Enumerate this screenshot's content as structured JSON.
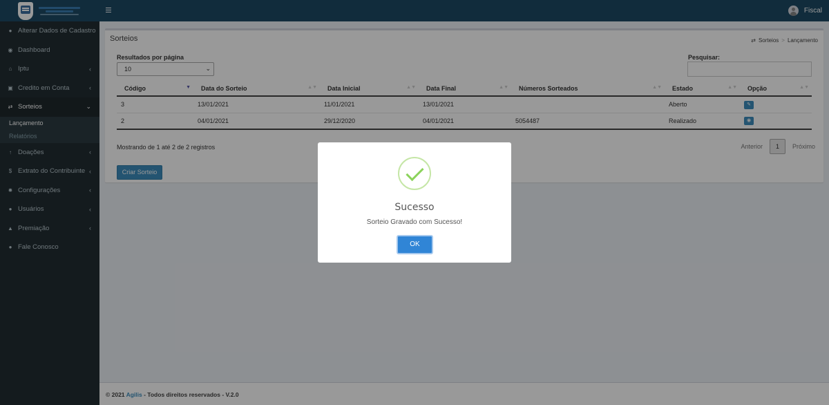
{
  "header": {
    "user_name": "Fiscal"
  },
  "sidebar": {
    "items": [
      {
        "label": "Alterar Dados de Cadastro",
        "icon": "user-icon"
      },
      {
        "label": "Dashboard",
        "icon": "dashboard-icon"
      },
      {
        "label": "Iptu",
        "icon": "home-icon"
      },
      {
        "label": "Credito em Conta",
        "icon": "money-icon"
      },
      {
        "label": "Sorteios",
        "icon": "random-icon"
      },
      {
        "label": "Doações",
        "icon": "gift-icon"
      },
      {
        "label": "Extrato do Contribuinte",
        "icon": "dollar-icon"
      },
      {
        "label": "Configurações",
        "icon": "gear-icon"
      },
      {
        "label": "Usuários",
        "icon": "user-icon"
      },
      {
        "label": "Premiação",
        "icon": "trophy-icon"
      },
      {
        "label": "Fale Conosco",
        "icon": "chat-icon"
      }
    ],
    "submenu": {
      "lancamento": "Lançamento",
      "relatorios": "Relatórios"
    }
  },
  "box": {
    "title": "Sorteios"
  },
  "breadcrumb": {
    "item1": "Sorteios",
    "item2": "Lançamento"
  },
  "table_controls": {
    "rpp_label": "Resultados por página",
    "rpp_value": "10",
    "search_label": "Pesquisar:",
    "search_value": ""
  },
  "table": {
    "columns": [
      "Código",
      "Data do Sorteio",
      "Data Inicial",
      "Data Final",
      "Números Sorteados",
      "Estado",
      "Opção"
    ],
    "rows": [
      [
        "3",
        "13/01/2021",
        "11/01/2021",
        "13/01/2021",
        "",
        "Aberto"
      ],
      [
        "2",
        "04/01/2021",
        "29/12/2020",
        "04/01/2021",
        "5054487",
        "Realizado"
      ]
    ]
  },
  "pagination": {
    "info": "Mostrando de 1 até 2 de 2 registros",
    "prev": "Anterior",
    "page": "1",
    "next": "Próximo"
  },
  "buttons": {
    "create": "Criar Sorteio"
  },
  "footer": {
    "prefix": "© 2021 ",
    "brand": "Agilis",
    "suffix": " - Todos direitos reservados - V.2.0"
  },
  "modal": {
    "title": "Sucesso",
    "text": "Sorteio Gravado com Sucesso!",
    "ok": "OK"
  },
  "colors": {
    "header": "#1d4a64",
    "sidebar": "#222d32",
    "primary": "#3c8dbc",
    "success": "#8cd35c"
  }
}
